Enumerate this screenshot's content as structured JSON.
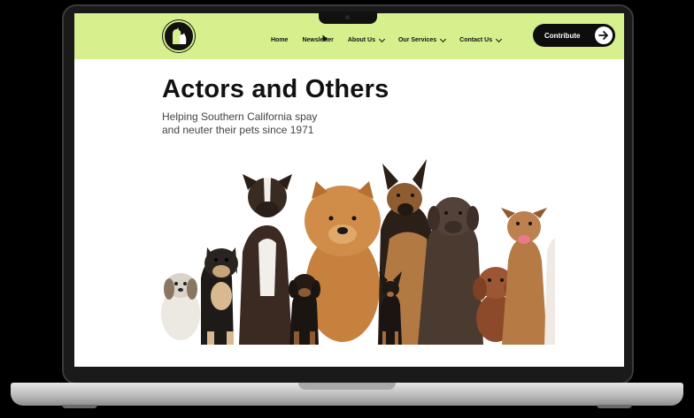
{
  "nav": {
    "items": [
      {
        "label": "Home",
        "has_dropdown": false
      },
      {
        "label": "Newsletter",
        "has_dropdown": false
      },
      {
        "label": "About Us",
        "has_dropdown": true
      },
      {
        "label": "Our Services",
        "has_dropdown": true
      },
      {
        "label": "Contact Us",
        "has_dropdown": true
      }
    ],
    "cta_label": "Contribute",
    "cta_icon": "arrow-right-icon",
    "background": "#d5f08d"
  },
  "hero": {
    "title": "Actors and Others",
    "subtitle_line1": "Helping Southern California spay",
    "subtitle_line2": "and neuter their pets since 1971"
  },
  "colors": {
    "accent": "#d5f08d",
    "cta_bg": "#0d0d0d"
  }
}
